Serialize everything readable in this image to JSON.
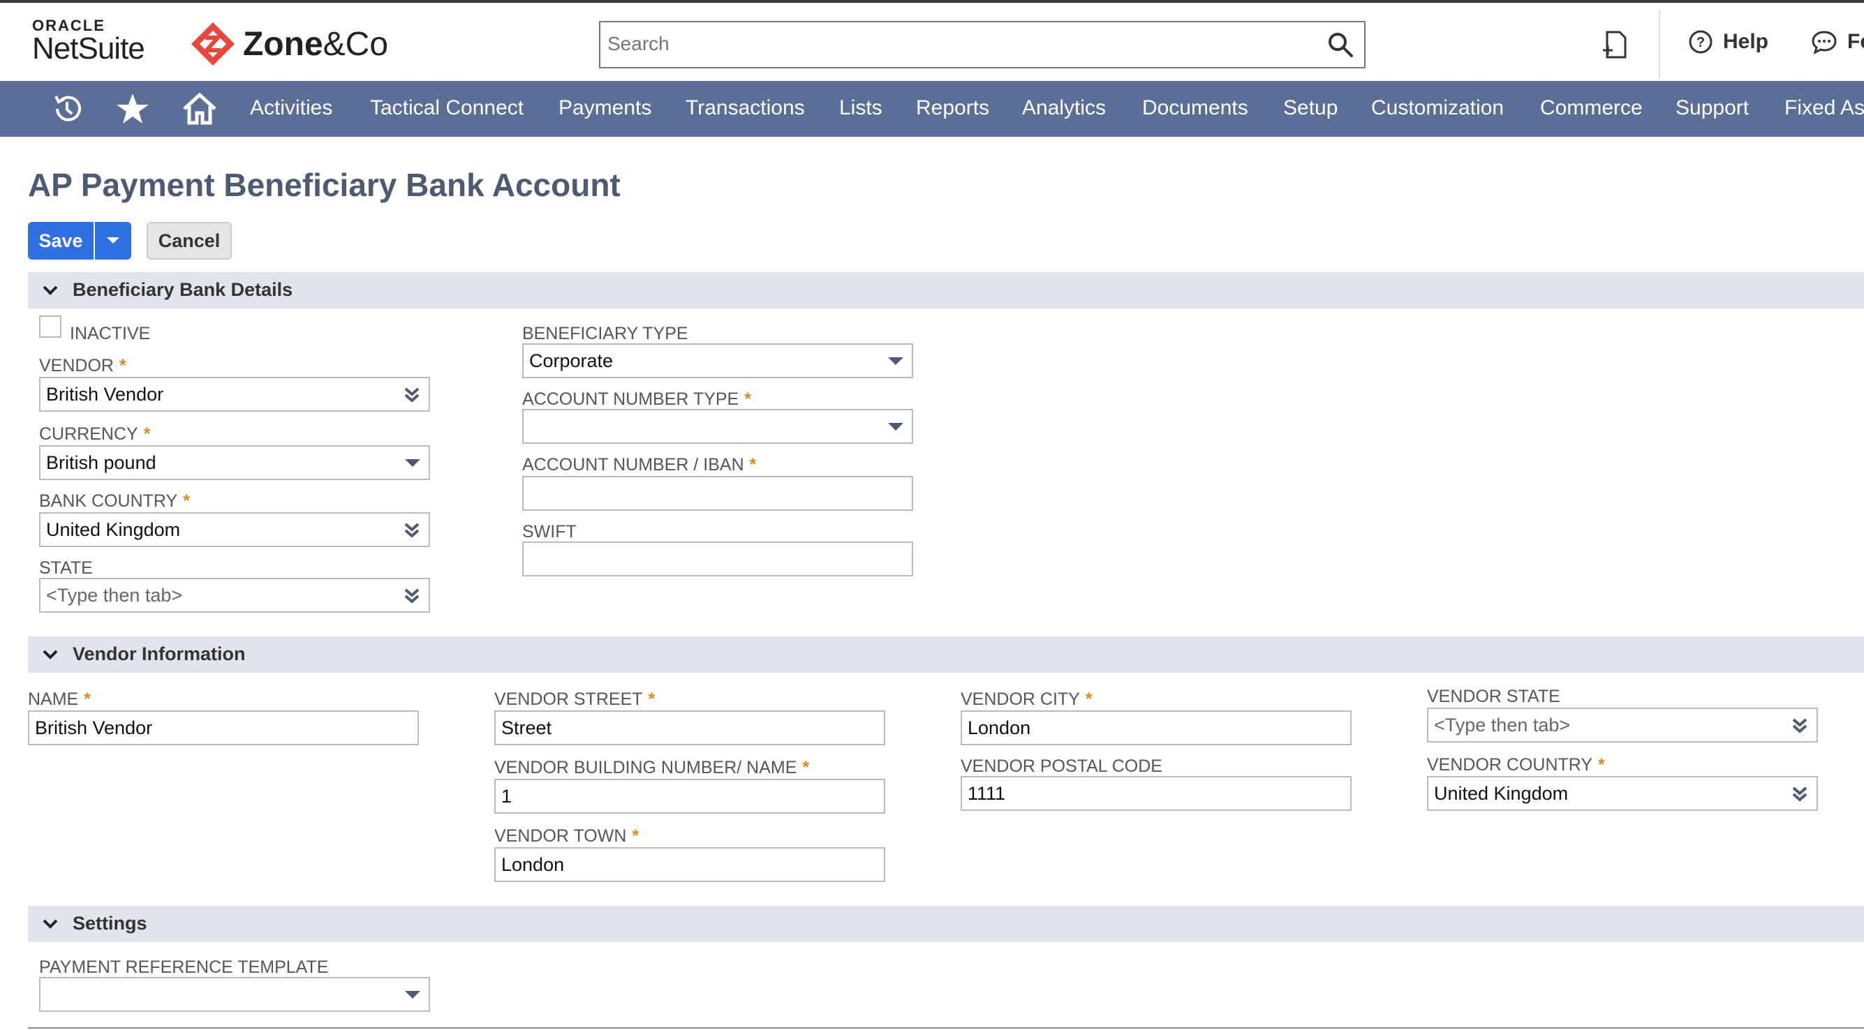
{
  "brand": {
    "oracle_line1": "ORACLE",
    "oracle_line2": "NetSuite",
    "partner_bold": "Zone",
    "partner_rest": "&Co"
  },
  "search": {
    "placeholder": "Search",
    "value": ""
  },
  "top_actions": {
    "help": "Help",
    "feedback": "Fe"
  },
  "nav": {
    "items": [
      "Activities",
      "Tactical Connect",
      "Payments",
      "Transactions",
      "Lists",
      "Reports",
      "Analytics",
      "Documents",
      "Setup",
      "Customization",
      "Commerce",
      "Support",
      "Fixed As"
    ]
  },
  "page": {
    "title": "AP Payment Beneficiary Bank Account"
  },
  "buttons": {
    "save": "Save",
    "cancel": "Cancel"
  },
  "sections": {
    "bank": {
      "title": "Beneficiary Bank Details",
      "inactive_label": "INACTIVE",
      "inactive_checked": false,
      "vendor": {
        "label": "VENDOR",
        "value": "British Vendor"
      },
      "currency": {
        "label": "CURRENCY",
        "value": "British pound"
      },
      "bank_country": {
        "label": "BANK COUNTRY",
        "value": "United Kingdom"
      },
      "state": {
        "label": "STATE",
        "placeholder": "<Type then tab>"
      },
      "beneficiary_type": {
        "label": "BENEFICIARY TYPE",
        "value": "Corporate"
      },
      "account_number_type": {
        "label": "ACCOUNT NUMBER TYPE",
        "value": ""
      },
      "account_number": {
        "label": "ACCOUNT NUMBER / IBAN",
        "value": ""
      },
      "swift": {
        "label": "SWIFT",
        "value": ""
      }
    },
    "vendor": {
      "title": "Vendor Information",
      "name": {
        "label": "NAME",
        "value": "British Vendor"
      },
      "street": {
        "label": "VENDOR STREET",
        "value": "Street"
      },
      "building": {
        "label": "VENDOR BUILDING NUMBER/ NAME",
        "value": "1"
      },
      "town": {
        "label": "VENDOR TOWN",
        "value": "London"
      },
      "city": {
        "label": "VENDOR CITY",
        "value": "London"
      },
      "postal": {
        "label": "VENDOR POSTAL CODE",
        "value": "1111"
      },
      "state": {
        "label": "VENDOR STATE",
        "placeholder": "<Type then tab>"
      },
      "country": {
        "label": "VENDOR COUNTRY",
        "value": "United Kingdom"
      }
    },
    "settings": {
      "title": "Settings",
      "payment_template": {
        "label": "PAYMENT REFERENCE TEMPLATE",
        "value": ""
      }
    }
  },
  "required_mark": "*",
  "colors": {
    "nav_bg": "#5b6f96",
    "primary_button": "#2f6fe0",
    "section_bg": "#e1e4ec",
    "required": "#d98c1c",
    "title": "#4d5a73"
  }
}
